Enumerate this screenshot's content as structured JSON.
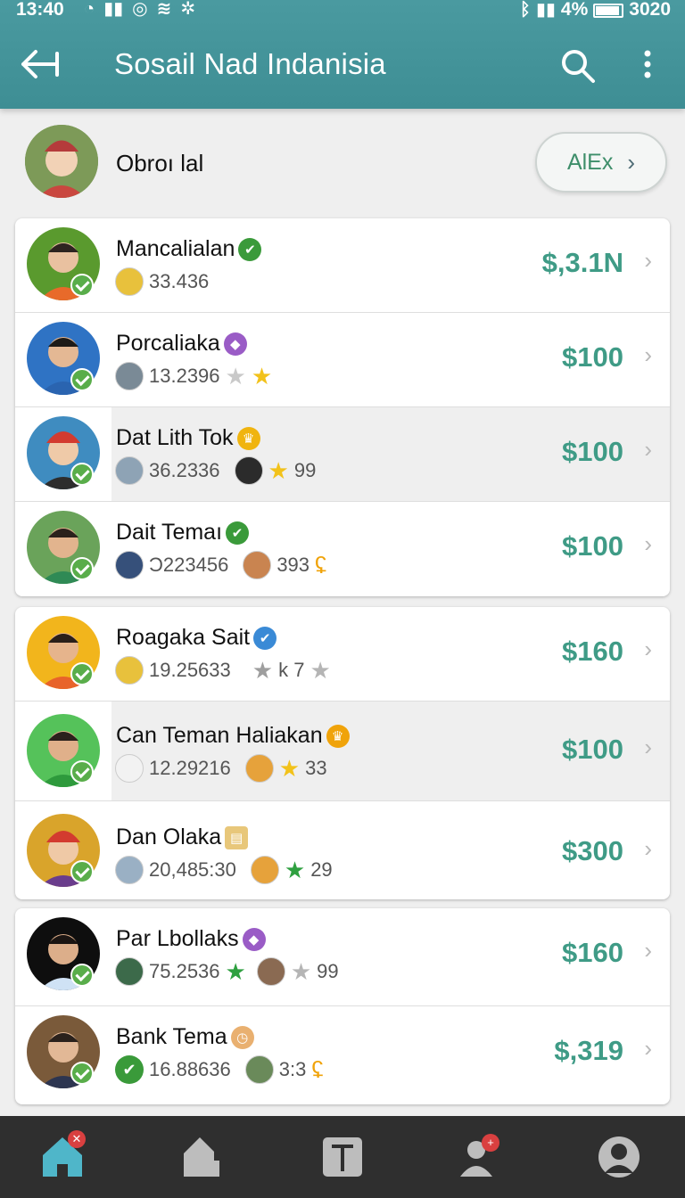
{
  "status_bar": {
    "time": "13:40",
    "battery_text": "4%",
    "right_text": "3020"
  },
  "app_bar": {
    "title": "Sosail Nad Indanisia",
    "icons": [
      "back-arrow-icon",
      "search-icon",
      "more-vert-icon"
    ]
  },
  "header": {
    "name": "Obroı lal",
    "pill_label": "AlEx",
    "pill_icon": "chevron-right-icon"
  },
  "colors": {
    "app_bar": "#4a9aa0",
    "accent_amount": "#3f9b86",
    "verified": "#59ad4a",
    "nav_bg": "#2f2f2f",
    "nav_active": "#4fb6c9"
  },
  "cards": [
    {
      "rows": [
        {
          "name": "Mancalialan",
          "name_badge": "✔",
          "stat": "33.436",
          "extra": "",
          "amount": "$,3.1N",
          "highlight": false
        },
        {
          "name": "Porcaliaka",
          "name_badge": "◆",
          "stat": "13.2396",
          "extra": "",
          "amount": "$100",
          "highlight": false
        },
        {
          "name": "Dat Lith Tok",
          "name_badge": "♛",
          "stat": "36.2336",
          "extra": "99",
          "amount": "$100",
          "highlight": true
        },
        {
          "name": "Dait Temaı",
          "name_badge": "✔",
          "stat": "Ͻ223456",
          "extra": "393",
          "amount": "$100",
          "highlight": false
        }
      ]
    },
    {
      "rows": [
        {
          "name": "Roagaka Sait",
          "name_badge": "✔",
          "stat": "19.25633",
          "extra": "k 7",
          "amount": "$160",
          "highlight": false
        },
        {
          "name": "Can Teman Haliakan",
          "name_badge": "♛",
          "stat": "12.29216",
          "extra": "33",
          "amount": "$100",
          "highlight": true
        },
        {
          "name": "Dan Olaka",
          "name_badge": "▤",
          "stat": "20,485:30",
          "extra": "29",
          "amount": "$300",
          "highlight": false
        }
      ]
    },
    {
      "rows": [
        {
          "name": "Par Lbollaks",
          "name_badge": "◆",
          "stat": "75.2536",
          "extra": "99",
          "amount": "$160",
          "highlight": false
        },
        {
          "name": "Bank Tema",
          "name_badge": "◷",
          "stat": "16.88636",
          "extra": "3:3",
          "amount": "$,319",
          "highlight": false
        }
      ]
    }
  ],
  "bottom_nav": [
    {
      "icon": "home-icon",
      "active": true,
      "badge": "✕"
    },
    {
      "icon": "store-icon",
      "active": false,
      "badge": ""
    },
    {
      "icon": "post-icon",
      "active": false,
      "badge": ""
    },
    {
      "icon": "friends-icon",
      "active": false,
      "badge": "+"
    },
    {
      "icon": "profile-icon",
      "active": false,
      "badge": ""
    }
  ]
}
